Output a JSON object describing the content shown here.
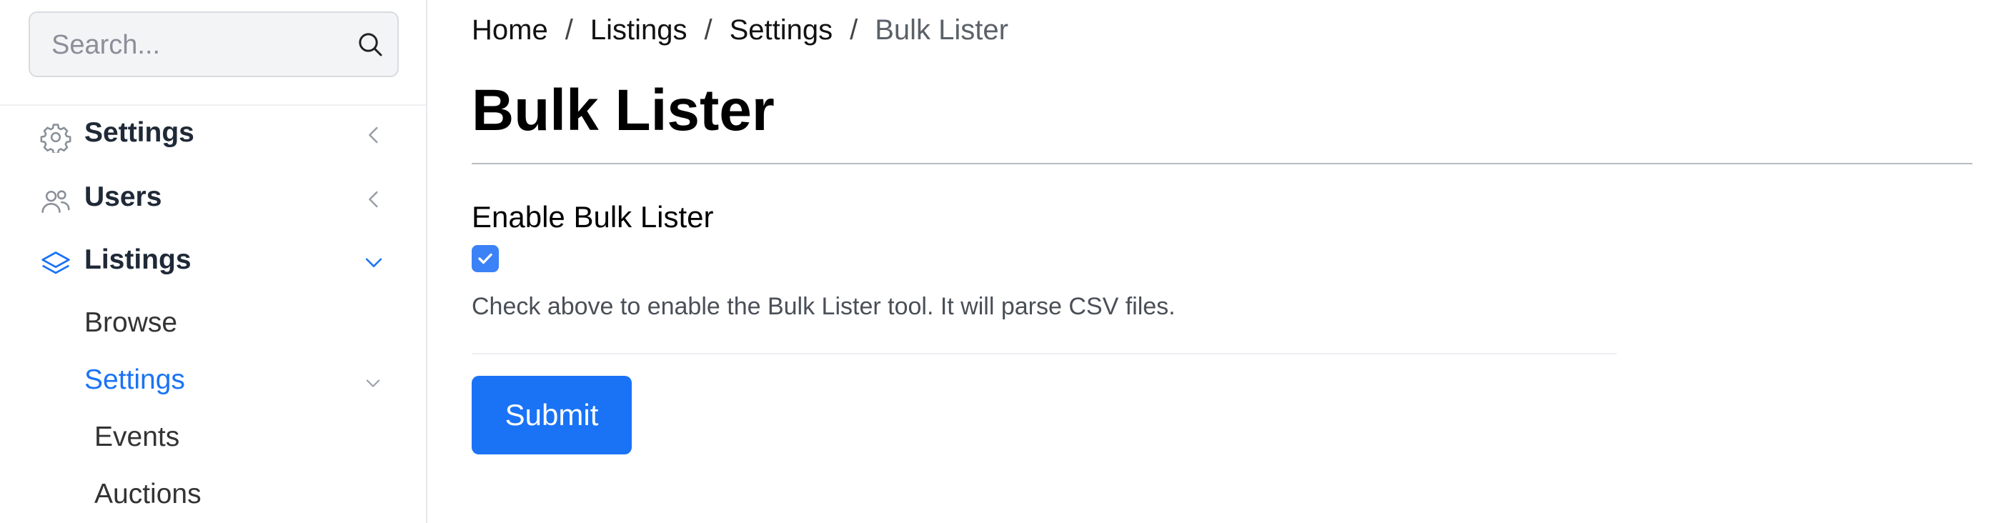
{
  "colors": {
    "accent": "#1a73f5",
    "checkbox": "#3b82f6",
    "active_nav": "#1a73f5",
    "text": "#111111",
    "muted": "#5b6169"
  },
  "search": {
    "placeholder": "Search...",
    "value": "",
    "icon": "search-icon"
  },
  "sidebar": {
    "items": [
      {
        "label": "Settings",
        "icon": "gear-icon",
        "chevron": "chevron-left-icon",
        "expanded": false
      },
      {
        "label": "Users",
        "icon": "users-icon",
        "chevron": "chevron-left-icon",
        "expanded": false
      },
      {
        "label": "Listings",
        "icon": "layers-icon",
        "chevron": "chevron-down-icon",
        "expanded": true
      }
    ],
    "listings_children": [
      {
        "label": "Browse"
      },
      {
        "label": "Settings",
        "active": true,
        "chevron": "chevron-down-icon"
      }
    ],
    "settings_children": [
      {
        "label": "Events"
      },
      {
        "label": "Auctions"
      }
    ]
  },
  "breadcrumb": {
    "items": [
      "Home",
      "Listings",
      "Settings"
    ],
    "current": "Bulk Lister",
    "separator": "/"
  },
  "page": {
    "title": "Bulk Lister"
  },
  "form": {
    "field_label": "Enable Bulk Lister",
    "checkbox_checked": true,
    "help_text": "Check above to enable the Bulk Lister tool. It will parse CSV files.",
    "submit_label": "Submit"
  }
}
